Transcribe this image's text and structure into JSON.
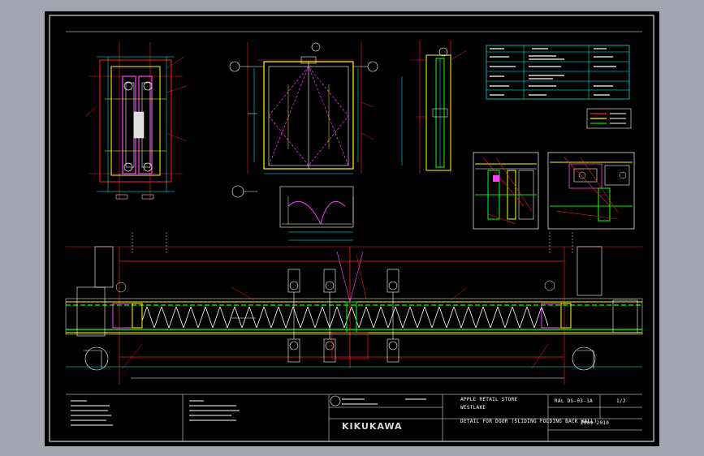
{
  "colors": {
    "background": "#a3a6b1",
    "sheet": "#000000",
    "frame": "#ffffff",
    "red": "#ff2020",
    "yellow": "#ffff00",
    "green": "#00e000",
    "cyan": "#00ffff",
    "magenta": "#ff40ff"
  },
  "title_block": {
    "project": "APPLE RETAIL STORE",
    "location": "WESTLAKE",
    "drawing_no": "RAL DS-03-1A",
    "sheet": "1/2",
    "drawing_title": "DETAIL FOR DOOR (SLIDING FOLDING BACK WALL)",
    "date": "2009 2010",
    "company": "KIKUKAWA"
  }
}
